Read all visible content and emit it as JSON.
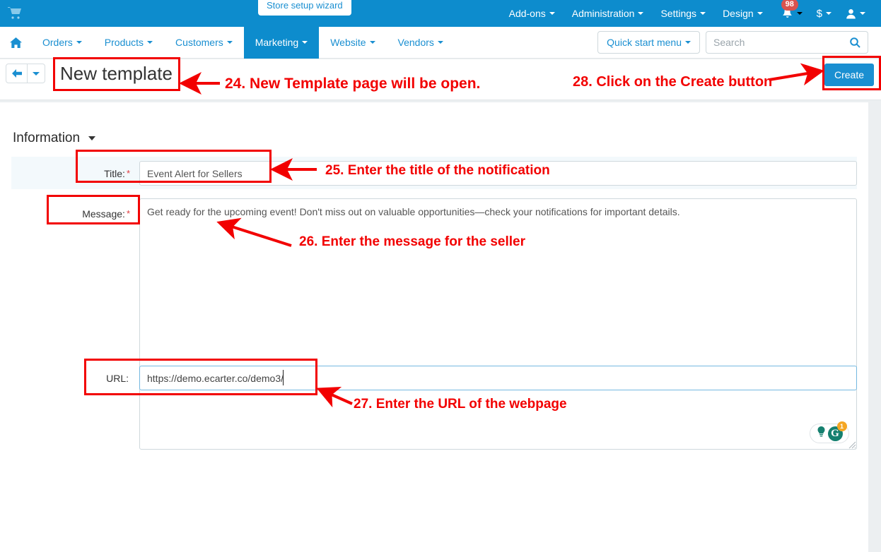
{
  "topbar": {
    "cart_icon": "shopping-cart-icon",
    "wizard_button": "Store setup wizard",
    "menus": [
      {
        "label": "Add-ons"
      },
      {
        "label": "Administration"
      },
      {
        "label": "Settings"
      },
      {
        "label": "Design"
      }
    ],
    "notifications": {
      "icon": "bell-icon",
      "count": "98"
    },
    "currency": {
      "icon": "dollar-icon",
      "label": "$"
    },
    "account": {
      "icon": "user-icon"
    }
  },
  "navbar": {
    "home_icon": "home-icon",
    "items": [
      {
        "label": "Orders",
        "active": false
      },
      {
        "label": "Products",
        "active": false
      },
      {
        "label": "Customers",
        "active": false
      },
      {
        "label": "Marketing",
        "active": true
      },
      {
        "label": "Website",
        "active": false
      },
      {
        "label": "Vendors",
        "active": false
      }
    ],
    "quick_start_menu": "Quick start menu",
    "search": {
      "placeholder": "Search",
      "value": "",
      "icon": "search-icon"
    }
  },
  "titlebar": {
    "back_icon": "arrow-left-icon",
    "back_caret_icon": "chevron-down-icon",
    "page_title": "New template",
    "create_button": "Create"
  },
  "main": {
    "section_title": "Information",
    "section_caret_icon": "chevron-down-icon",
    "fields": {
      "title": {
        "label": "Title:",
        "required_marker": "*",
        "value": "Event Alert for Sellers",
        "placeholder": ""
      },
      "message": {
        "label": "Message:",
        "required_marker": "*",
        "value": "Get ready for the upcoming event! Don't miss out on valuable opportunities—check your notifications for important details.",
        "placeholder": ""
      },
      "url": {
        "label": "URL:",
        "required_marker": "",
        "value": "https://demo.ecarter.co/demo3/",
        "placeholder": ""
      }
    },
    "grammarly": {
      "bulb_icon": "lightbulb-icon",
      "logo_icon": "grammarly-g-icon",
      "logo_letter": "G",
      "badge_count": "1"
    },
    "resize_grip_icon": "resize-handle-icon"
  },
  "annotations": {
    "color": "#f20000",
    "steps": [
      {
        "id": "24",
        "text": "24. New Template page will be open."
      },
      {
        "id": "25",
        "text": "25. Enter the title of the notification"
      },
      {
        "id": "26",
        "text": "26. Enter the message for the seller"
      },
      {
        "id": "27",
        "text": "27. Enter the URL of the webpage"
      },
      {
        "id": "28",
        "text": "28. Click on the Create button"
      }
    ]
  },
  "colors": {
    "header_blue": "#0d8ccd",
    "link_blue": "#1a8fd1",
    "annotation_red": "#f20000",
    "required_red": "#e0393e",
    "row_highlight": "#f3f9fc"
  }
}
